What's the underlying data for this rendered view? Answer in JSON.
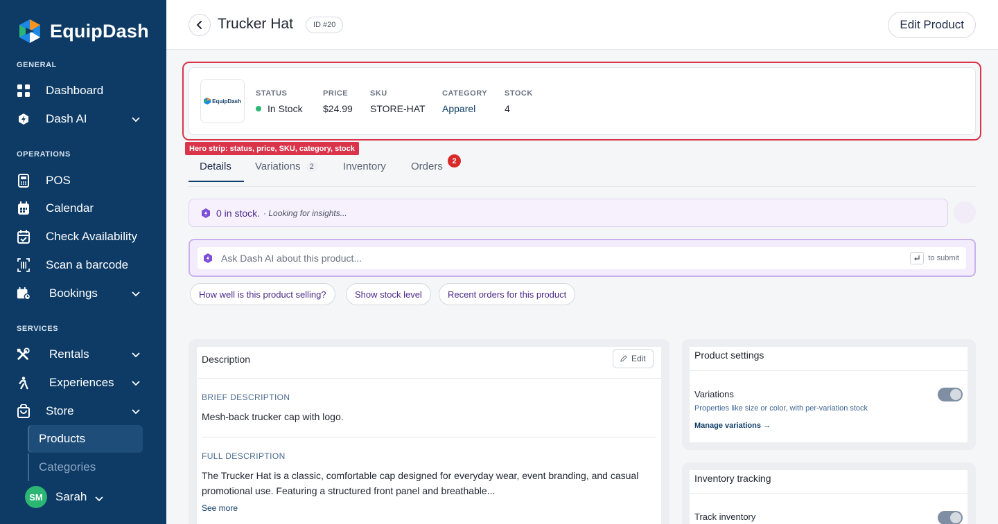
{
  "sidebar": {
    "brand": "EquipDash",
    "sections": {
      "general": "GENERAL",
      "operations": "OPERATIONS",
      "services": "SERVICES"
    },
    "items": {
      "dashboard": "Dashboard",
      "dash_ai": "Dash AI",
      "pos": "POS",
      "calendar": "Calendar",
      "check_availability": "Check Availability",
      "scan_barcode": "Scan a barcode",
      "bookings": "Bookings",
      "rentals": "Rentals",
      "experiences": "Experiences",
      "store": "Store",
      "products": "Products",
      "categories": "Categories"
    },
    "user": {
      "initials": "SM",
      "name": "Sarah"
    }
  },
  "header": {
    "title": "Trucker Hat",
    "id_chip": "ID #20",
    "edit_button": "Edit Product"
  },
  "hero": {
    "logo_text": "EquipDash",
    "status_label": "STATUS",
    "status_value": "In Stock",
    "price_label": "PRICE",
    "price_value": "$24.99",
    "sku_label": "SKU",
    "sku_value": "STORE-HAT",
    "category_label": "CATEGORY",
    "category_value": "Apparel",
    "stock_label": "STOCK",
    "stock_value": "4",
    "annotation": "Hero strip: status, price, SKU, category, stock"
  },
  "tabs": {
    "details": "Details",
    "variations": "Variations",
    "variations_count": "2",
    "inventory": "Inventory",
    "orders": "Orders",
    "orders_badge": "2"
  },
  "ai": {
    "insight_primary": "0 in stock.",
    "insight_secondary": "· Looking for insights...",
    "ask_placeholder": "Ask Dash AI about this product...",
    "submit_hint": "to submit",
    "suggestions": [
      "How well is this product selling?",
      "Show stock level",
      "Recent orders for this product"
    ]
  },
  "description_card": {
    "title": "Description",
    "edit": "Edit",
    "brief_label": "BRIEF DESCRIPTION",
    "brief_text": "Mesh-back trucker cap with logo.",
    "full_label": "FULL DESCRIPTION",
    "full_text": "The Trucker Hat is a classic, comfortable cap designed for everyday wear, event branding, and casual promotional use. Featuring a structured front panel and breathable...",
    "see_more": "See more"
  },
  "product_settings": {
    "title": "Product settings",
    "variations_name": "Variations",
    "variations_sub": "Properties like size or color, with per-variation stock",
    "variations_link": "Manage variations →",
    "variations_enabled": true
  },
  "inventory_tracking": {
    "title": "Inventory tracking",
    "track_name": "Track inventory",
    "track_enabled": true
  },
  "colors": {
    "sidebar": "#0d3b66",
    "accent": "#0d3b66",
    "annotation": "#d9344a",
    "ai": "#4b2a8a",
    "in_stock": "#2bb673"
  }
}
